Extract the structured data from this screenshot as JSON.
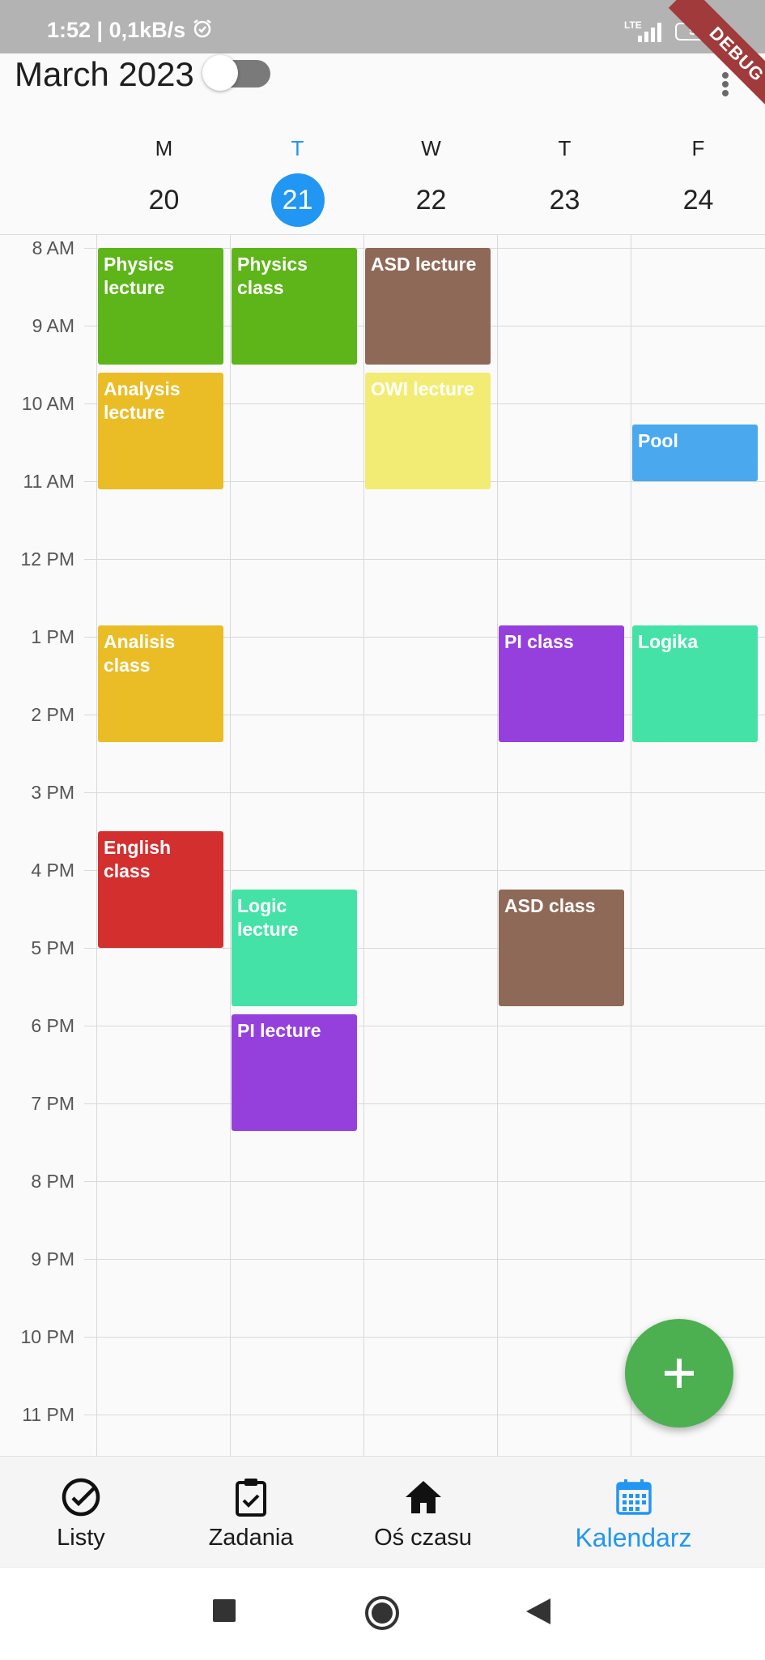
{
  "status_bar": {
    "time": "1:52",
    "speed": "0,1kB/s",
    "network": "LTE",
    "battery": "51"
  },
  "debug_banner": "DEBUG",
  "header": {
    "month_title": "March 2023",
    "toggle_on": false
  },
  "days": [
    {
      "dow": "M",
      "date": "20",
      "today": false
    },
    {
      "dow": "T",
      "date": "21",
      "today": true
    },
    {
      "dow": "W",
      "date": "22",
      "today": false
    },
    {
      "dow": "T",
      "date": "23",
      "today": false
    },
    {
      "dow": "F",
      "date": "24",
      "today": false
    }
  ],
  "hours": [
    "8 AM",
    "9 AM",
    "10 AM",
    "11 AM",
    "12 PM",
    "1 PM",
    "2 PM",
    "3 PM",
    "4 PM",
    "5 PM",
    "6 PM",
    "7 PM",
    "8 PM",
    "9 PM",
    "10 PM",
    "11 PM"
  ],
  "events": [
    {
      "title": "Physics lecture",
      "day": 0,
      "start": 8.0,
      "end": 9.5,
      "color": "#5eb51a"
    },
    {
      "title": "Analysis lecture",
      "day": 0,
      "start": 9.6,
      "end": 11.1,
      "color": "#eabd27"
    },
    {
      "title": "Analisis class",
      "day": 0,
      "start": 12.85,
      "end": 14.35,
      "color": "#eabd27"
    },
    {
      "title": "English class",
      "day": 0,
      "start": 15.5,
      "end": 17.0,
      "color": "#d32f2f"
    },
    {
      "title": "Physics class",
      "day": 1,
      "start": 8.0,
      "end": 9.5,
      "color": "#5eb51a"
    },
    {
      "title": "Logic lecture",
      "day": 1,
      "start": 16.25,
      "end": 17.75,
      "color": "#45e2a8"
    },
    {
      "title": "PI lecture",
      "day": 1,
      "start": 17.85,
      "end": 19.35,
      "color": "#9540dd"
    },
    {
      "title": "ASD lecture",
      "day": 2,
      "start": 8.0,
      "end": 9.5,
      "color": "#8f6958"
    },
    {
      "title": "OWI lecture",
      "day": 2,
      "start": 9.6,
      "end": 11.1,
      "color": "#f3ec74"
    },
    {
      "title": "PI class",
      "day": 3,
      "start": 12.85,
      "end": 14.35,
      "color": "#9540dd"
    },
    {
      "title": "ASD class",
      "day": 3,
      "start": 16.25,
      "end": 17.75,
      "color": "#8f6958"
    },
    {
      "title": "Pool",
      "day": 4,
      "start": 10.27,
      "end": 11.0,
      "color": "#4aa8ef"
    },
    {
      "title": "Logika",
      "day": 4,
      "start": 12.85,
      "end": 14.35,
      "color": "#45e2a8"
    }
  ],
  "fab": {
    "icon": "plus-icon"
  },
  "bottom_nav": [
    {
      "label": "Listy",
      "icon": "check-circle-icon",
      "active": false
    },
    {
      "label": "Zadania",
      "icon": "clipboard-check-icon",
      "active": false
    },
    {
      "label": "Oś czasu",
      "icon": "home-icon",
      "active": false
    },
    {
      "label": "Kalendarz",
      "icon": "calendar-icon",
      "active": true
    }
  ],
  "colors": {
    "accent": "#2196f3",
    "fab": "#4caf50",
    "status_bar": "#b3b3b3"
  }
}
